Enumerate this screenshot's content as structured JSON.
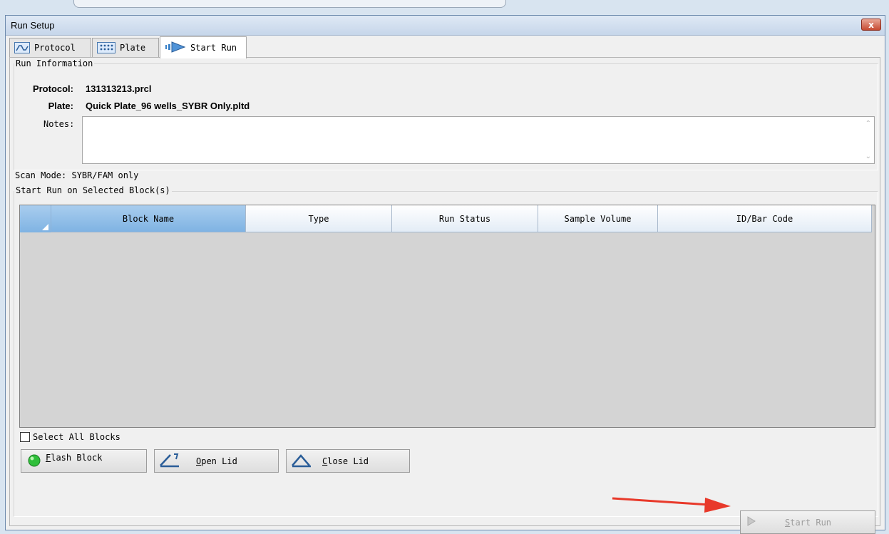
{
  "window": {
    "title": "Run Setup",
    "close_label": "x"
  },
  "tabs": [
    {
      "label": "Protocol",
      "icon": "protocol-icon"
    },
    {
      "label": "Plate",
      "icon": "plate-icon"
    },
    {
      "label": "Start Run",
      "icon": "start-run-icon",
      "active": true
    }
  ],
  "run_info": {
    "legend": "Run Information",
    "protocol_label": "Protocol:",
    "protocol_value": "131313213.prcl",
    "plate_label": "Plate:",
    "plate_value": "Quick Plate_96 wells_SYBR Only.pltd",
    "notes_label": "Notes:",
    "notes_value": "",
    "scan_mode": "Scan Mode:  SYBR/FAM only"
  },
  "blocks": {
    "legend": "Start Run on Selected Block(s)",
    "columns": [
      "Block Name",
      "Type",
      "Run Status",
      "Sample Volume",
      "ID/Bar Code"
    ],
    "rows": []
  },
  "select_all": {
    "label": "Select All Blocks",
    "checked": false
  },
  "buttons": {
    "flash_block_hotkey": "F",
    "flash_block_rest": "lash Block",
    "open_lid_hotkey": "O",
    "open_lid_rest": "pen Lid",
    "close_lid_hotkey": "C",
    "close_lid_rest": "lose Lid",
    "start_run_hotkey": "S",
    "start_run_rest": "tart Run",
    "start_run_enabled": false
  },
  "colors": {
    "annotation_arrow": "#e8392a",
    "selected_header": "#7fb3e3"
  }
}
